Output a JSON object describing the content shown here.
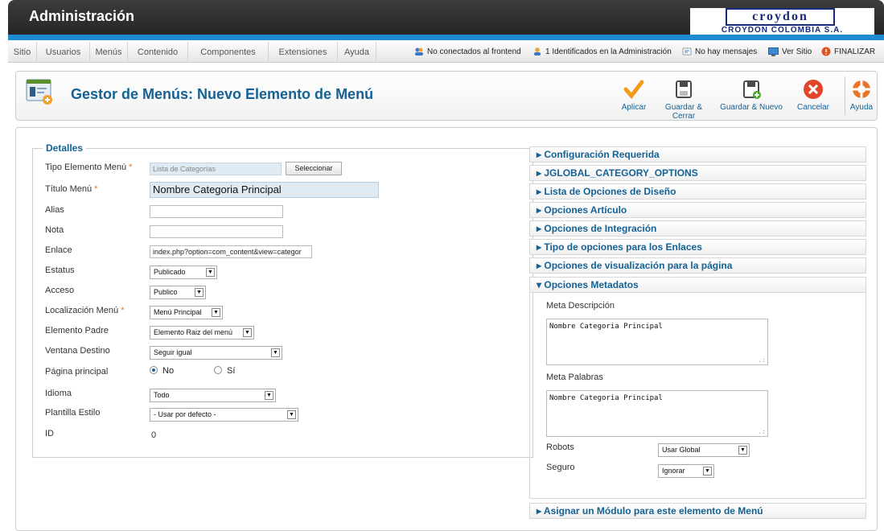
{
  "header": {
    "title": "Administración",
    "logo_word": "croydon",
    "logo_sub": "CROYDON COLOMBIA S.A."
  },
  "menu": {
    "items": [
      "Sitio",
      "Usuarios",
      "Menús",
      "Contenido",
      "Componentes",
      "Extensiones",
      "Ayuda"
    ],
    "status": {
      "frontend": "No conectados al frontend",
      "admin": "1 Identificados en la Administración",
      "messages": "No hay mensajes",
      "view_site": "Ver Sitio",
      "logout": "FINALIZAR"
    }
  },
  "toolbar": {
    "page_title": "Gestor de Menús: Nuevo Elemento de Menú",
    "buttons": [
      "Aplicar",
      "Guardar & Cerrar",
      "Guardar & Nuevo",
      "Cancelar",
      "Ayuda"
    ]
  },
  "details": {
    "legend": "Detalles",
    "fields": {
      "type": {
        "label": "Tipo Elemento Menú",
        "value": "Lista de Categorías",
        "button": "Seleccionar"
      },
      "title": {
        "label": "Título Menú",
        "value": "Nombre Categoria Principal"
      },
      "alias": {
        "label": "Alias",
        "value": ""
      },
      "note": {
        "label": "Nota",
        "value": ""
      },
      "link": {
        "label": "Enlace",
        "value": "index.php?option=com_content&view=categor"
      },
      "status": {
        "label": "Estatus",
        "value": "Publicado"
      },
      "access": {
        "label": "Acceso",
        "value": "Publico"
      },
      "menu_location": {
        "label": "Localización Menú",
        "value": "Menú Principal"
      },
      "parent": {
        "label": "Elemento Padre",
        "value": "Elemento Raiz del menú"
      },
      "target": {
        "label": "Ventana Destino",
        "value": "Seguir igual"
      },
      "home": {
        "label": "Página principal",
        "options": [
          "No",
          "Sí"
        ],
        "selected": "No"
      },
      "language": {
        "label": "Idioma",
        "value": "Todo"
      },
      "template": {
        "label": "Plantilla Estilo",
        "value": "- Usar por defecto -"
      },
      "id": {
        "label": "ID",
        "value": "0"
      }
    },
    "required_marker": "*"
  },
  "panels": {
    "items": [
      "Configuración Requerida",
      "JGLOBAL_CATEGORY_OPTIONS",
      "Lista de Opciones de Diseño",
      "Opciones Artículo",
      "Opciones de Integración",
      "Tipo de opciones para los Enlaces",
      "Opciones de visualización para la página"
    ],
    "open": "Opciones Metadatos",
    "last": "Asignar un Módulo para este elemento de Menú",
    "meta": {
      "desc_label": "Meta Descripción",
      "desc_value": "Nombre Categoria Principal",
      "keywords_label": "Meta Palabras",
      "keywords_value": "Nombre Categoria Principal",
      "robots_label": "Robots",
      "robots_value": "Usar Global",
      "secure_label": "Seguro",
      "secure_value": "Ignorar"
    }
  },
  "colors": {
    "accent": "#146295",
    "header_bg": "#2e2e2e",
    "bar_blue": "#1d8bd0"
  }
}
